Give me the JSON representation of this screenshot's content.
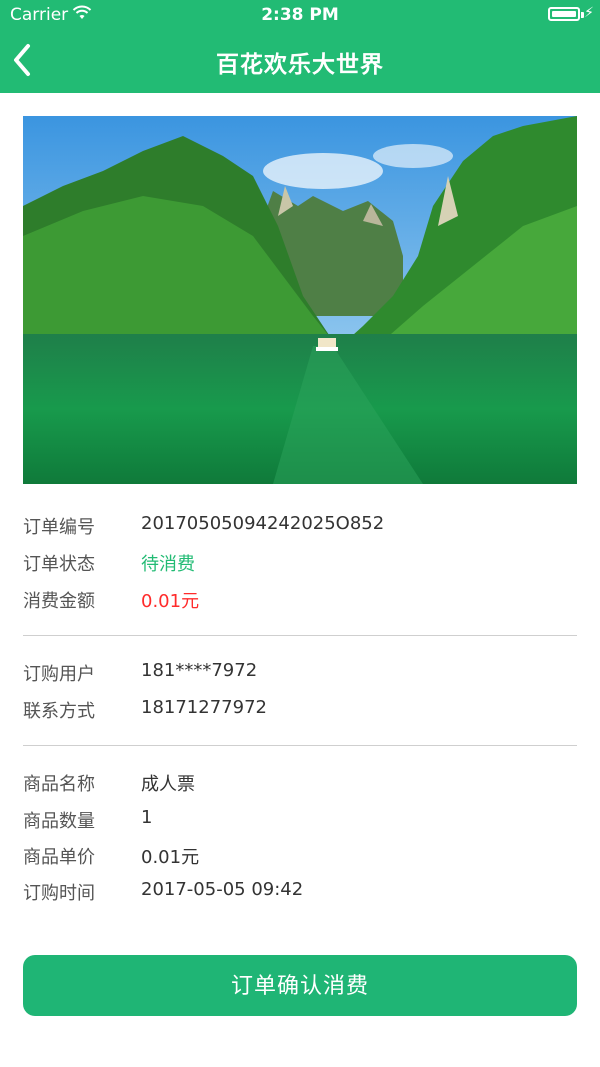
{
  "status_bar": {
    "carrier": "Carrier",
    "time": "2:38 PM"
  },
  "nav": {
    "title": "百花欢乐大世界"
  },
  "order": [
    {
      "label": "订单编号",
      "value": "20170505094242025O852",
      "tone": "normal"
    },
    {
      "label": "订单状态",
      "value": "待消费",
      "tone": "green"
    },
    {
      "label": "消费金额",
      "value": "0.01元",
      "tone": "red"
    }
  ],
  "buyer": [
    {
      "label": "订购用户",
      "value": "181****7972"
    },
    {
      "label": "联系方式",
      "value": "18171277972"
    }
  ],
  "product": [
    {
      "label": "商品名称",
      "value": "成人票"
    },
    {
      "label": "商品数量",
      "value": "1"
    },
    {
      "label": "商品单价",
      "value": "0.01元"
    },
    {
      "label": "订购时间",
      "value": "2017-05-05 09:42"
    }
  ],
  "confirm_label": "订单确认消费",
  "colors": {
    "brand": "#22bb74",
    "price": "#ff2b2b"
  }
}
